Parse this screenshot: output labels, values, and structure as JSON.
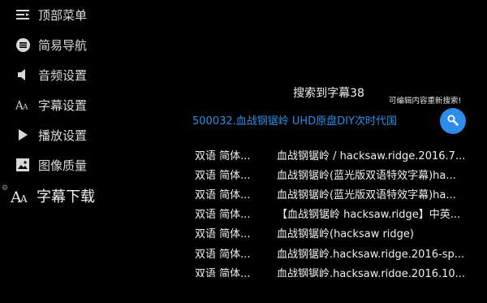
{
  "sidebar": {
    "items": [
      {
        "label": "顶部菜单",
        "icon": "list-icon"
      },
      {
        "label": "简易导航",
        "icon": "menu-circle-icon"
      },
      {
        "label": "音频设置",
        "icon": "speaker-icon"
      },
      {
        "label": "字幕设置",
        "icon": "subtitle-icon"
      },
      {
        "label": "播放设置",
        "icon": "play-icon"
      },
      {
        "label": "图像质量",
        "icon": "image-icon"
      },
      {
        "label": "字幕下载",
        "icon": "subtitle-download-icon"
      }
    ],
    "active_index": 6
  },
  "main": {
    "title": "搜索到字幕38",
    "hint": "可编辑内容重新搜索!",
    "search_value": "500032.血战钢锯岭 UHD原盘DIY次时代国",
    "search_button_icon": "search-icon",
    "results": [
      {
        "lang": "双语 简体...",
        "name": "血战钢锯岭 / hacksaw.ridge.2016.7..."
      },
      {
        "lang": "双语 简体...",
        "name": "血战钢锯岭(蓝光版双语特效字幕)ha..."
      },
      {
        "lang": "双语 简体...",
        "name": "血战钢锯岭(蓝光版双语特效字幕)ha..."
      },
      {
        "lang": "双语 简体...",
        "name": "【血战钢锯岭 hacksaw.ridge】中英..."
      },
      {
        "lang": "双语 简体...",
        "name": "血战钢锯岭(hacksaw ridge)"
      },
      {
        "lang": "双语 简体...",
        "name": "血战钢锯岭.hacksaw.ridge.2016-sp..."
      },
      {
        "lang": "双语 简体...",
        "name": "血战钢锯岭.hacksaw.ridge.2016.10..."
      }
    ]
  },
  "colors": {
    "background": "#000000",
    "accent": "#2c8ce6",
    "text": "#f0f0f0"
  }
}
